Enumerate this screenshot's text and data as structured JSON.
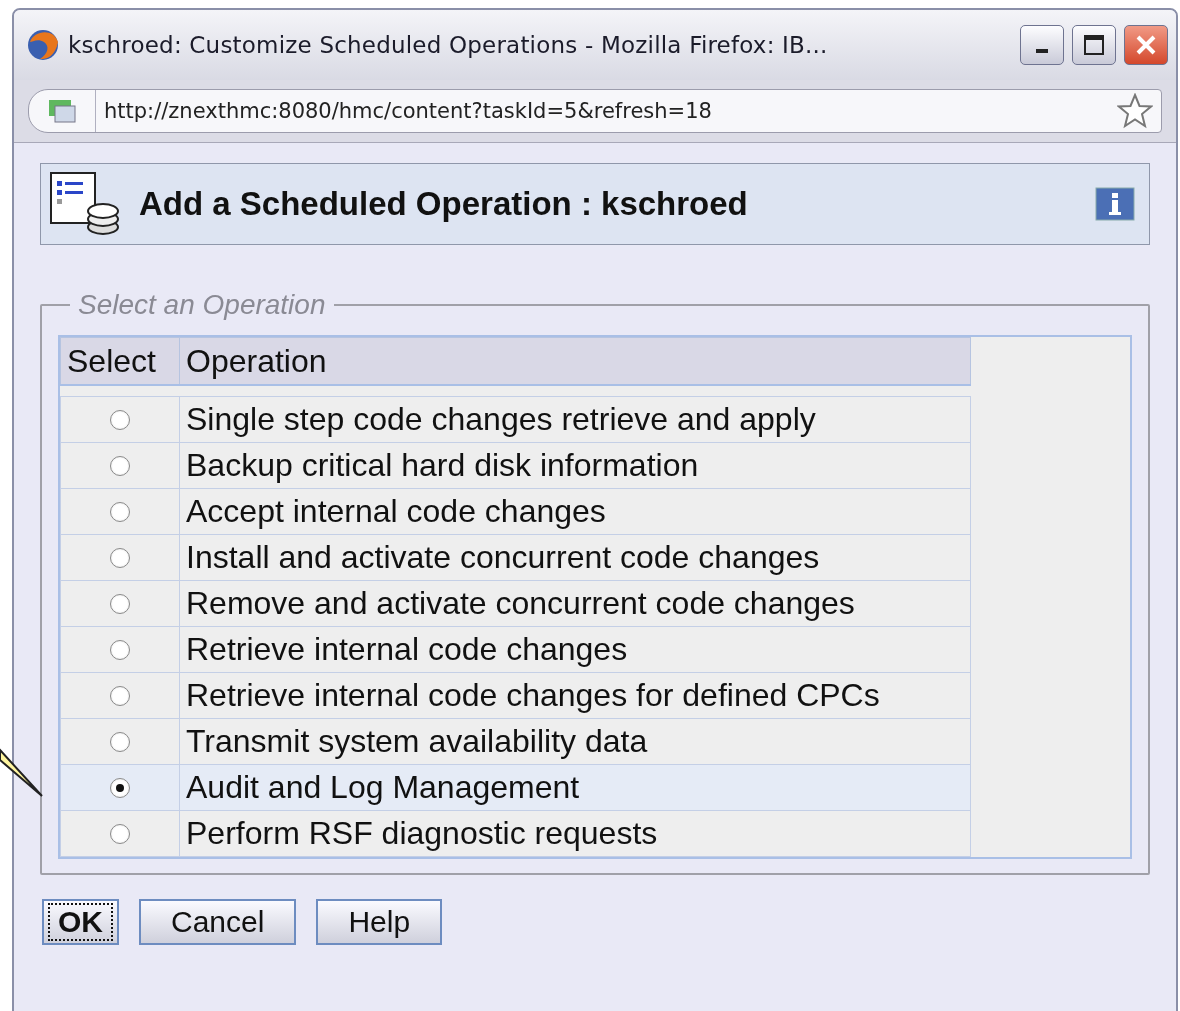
{
  "window": {
    "title": "kschroed: Customize Scheduled Operations - Mozilla Firefox: IB..."
  },
  "address_bar": {
    "url": "http://znexthmc:8080/hmc/content?taskId=5&refresh=18"
  },
  "header": {
    "title": "Add a Scheduled Operation : kschroed"
  },
  "group": {
    "legend": "Select an Operation"
  },
  "table": {
    "columns": [
      "Select",
      "Operation"
    ],
    "rows": [
      {
        "operation": "Single step code changes retrieve and apply",
        "selected": false
      },
      {
        "operation": "Backup critical hard disk information",
        "selected": false
      },
      {
        "operation": "Accept internal code changes",
        "selected": false
      },
      {
        "operation": "Install and activate concurrent code changes",
        "selected": false
      },
      {
        "operation": "Remove and activate concurrent code changes",
        "selected": false
      },
      {
        "operation": "Retrieve internal code changes",
        "selected": false
      },
      {
        "operation": "Retrieve internal code changes for defined CPCs",
        "selected": false
      },
      {
        "operation": "Transmit system availability data",
        "selected": false
      },
      {
        "operation": "Audit and Log Management",
        "selected": true
      },
      {
        "operation": "Perform RSF diagnostic requests",
        "selected": false
      }
    ]
  },
  "buttons": [
    {
      "label": "OK",
      "focused": true
    },
    {
      "label": "Cancel",
      "focused": false
    },
    {
      "label": "Help",
      "focused": false
    }
  ]
}
